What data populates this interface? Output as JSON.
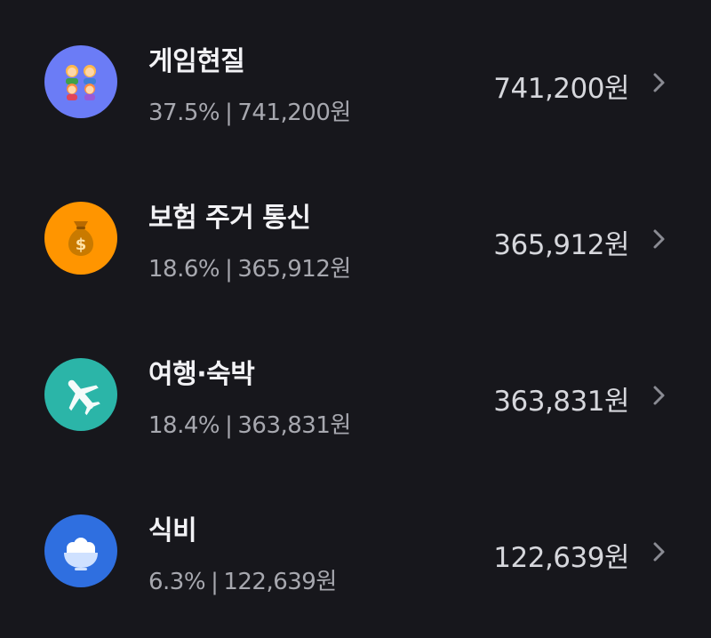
{
  "categories": [
    {
      "icon": "family-icon",
      "icon_color": "#6b7cf6",
      "title": "게임현질",
      "percent": "37.5%",
      "separator": "|",
      "sub_amount": "741,200원",
      "amount": "741,200원"
    },
    {
      "icon": "money-bag-icon",
      "icon_color": "#ff9500",
      "title": "보험 주거 통신",
      "percent": "18.6%",
      "separator": "|",
      "sub_amount": "365,912원",
      "amount": "365,912원"
    },
    {
      "icon": "airplane-icon",
      "icon_color": "#2bb5a8",
      "title": "여행·숙박",
      "percent": "18.4%",
      "separator": "|",
      "sub_amount": "363,831원",
      "amount": "363,831원"
    },
    {
      "icon": "rice-bowl-icon",
      "icon_color": "#2f6fe0",
      "title": "식비",
      "percent": "6.3%",
      "separator": "|",
      "sub_amount": "122,639원",
      "amount": "122,639원"
    }
  ]
}
